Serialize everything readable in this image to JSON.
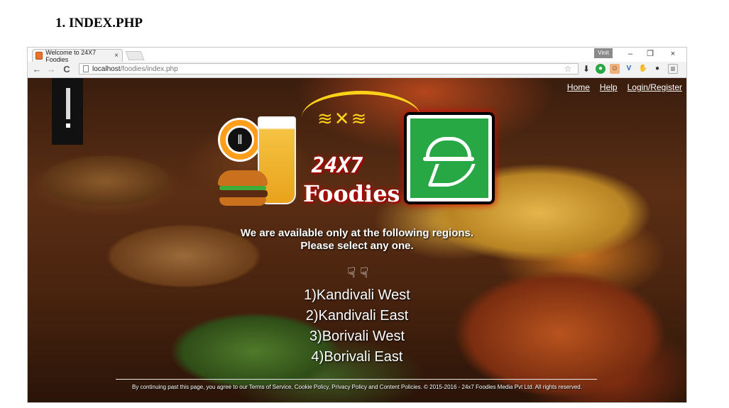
{
  "document": {
    "heading": "1.   INDEX.PHP"
  },
  "browser": {
    "tab_title": "Welcome to 24X7 Foodies",
    "tab_close": "×",
    "user_badge": "Vinit",
    "window_minimize": "–",
    "window_restore": "❐",
    "window_close": "×",
    "back": "←",
    "forward": "→",
    "reload": "C",
    "url_host": "localhost",
    "url_path": "/foodies/index.php",
    "toolbar_icons": [
      "star-icon",
      "download-icon",
      "extension-green-icon",
      "extension-avatar-icon",
      "extension-v-icon",
      "extension-hand-icon",
      "extension-bulb-icon",
      "menu-icon"
    ]
  },
  "nav": {
    "home": "Home",
    "help": "Help",
    "login_register": "Login/Register"
  },
  "logo": {
    "line1": "24X7",
    "line2": "Foodies",
    "fish": "≋✕≋"
  },
  "content": {
    "line1": "We are available only at the following regions.",
    "line2": "Please select any one.",
    "pointer_icon": "☟ ☟",
    "regions": [
      "1)Kandivali West",
      "2)Kandivali East",
      "3)Borivali West",
      "4)Borivali East"
    ]
  },
  "footer": {
    "text": "By continuing past this page, you agree to our Terms of Service, Cookie Policy, Privacy Policy and Content Policies. © 2015-2016 - 24x7 Foodies Media Pvt Ltd. All rights reserved."
  },
  "colors": {
    "accent_green": "#27a844",
    "accent_orange": "#ff9e1b",
    "logo_glow": "#d10000"
  }
}
